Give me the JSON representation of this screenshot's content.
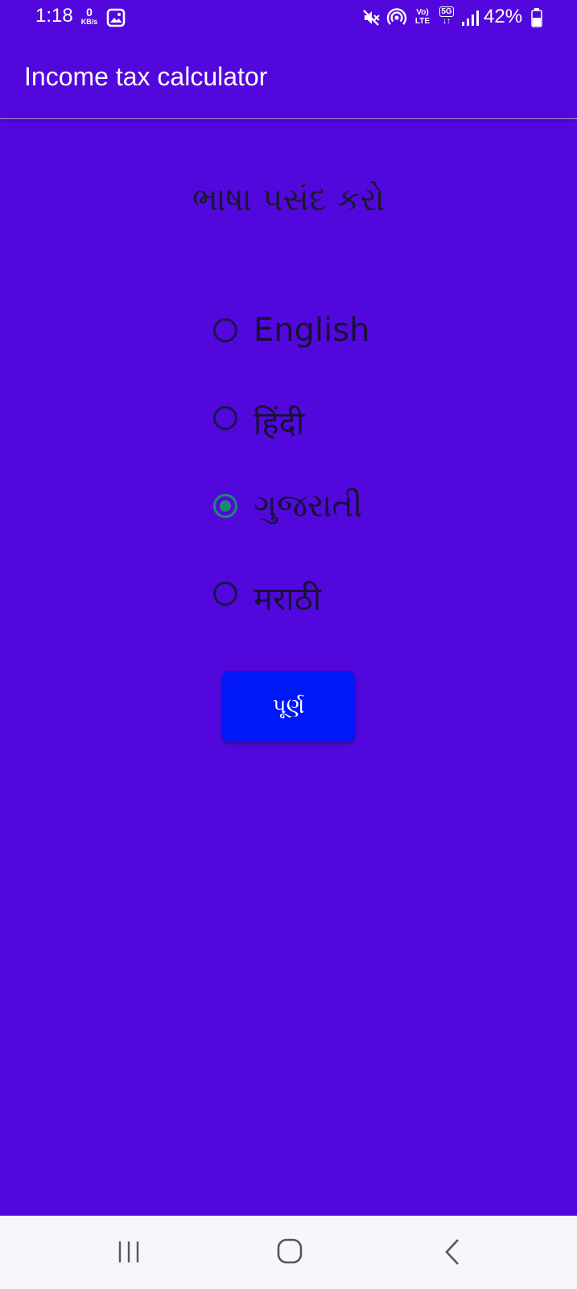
{
  "status_bar": {
    "time": "1:18",
    "net_speed_value": "0",
    "net_speed_unit": "KB/s",
    "volte_line1": "Vo)",
    "volte_line2": "LTE",
    "network_type": "5G",
    "battery_percent": "42%",
    "icons": [
      "gallery-icon",
      "mute-icon",
      "hotspot-icon",
      "volte-icon",
      "network-5g-icon",
      "signal-icon",
      "battery-icon"
    ]
  },
  "app_bar": {
    "title": "Income tax calculator"
  },
  "main": {
    "heading": "ભાષા પસંદ કરો",
    "language_options": [
      {
        "label": "English",
        "selected": false
      },
      {
        "label": "हिंदी",
        "selected": false
      },
      {
        "label": "ગુજરાતી",
        "selected": true
      },
      {
        "label": "मराठी",
        "selected": false
      }
    ],
    "done_button_label": "પૂર્ણ"
  },
  "nav_bar": {
    "icons": [
      "recent-apps-icon",
      "home-icon",
      "back-icon"
    ]
  },
  "colors": {
    "background": "#5208DC",
    "button": "#0018F8",
    "radio_selected": "#1b8a72",
    "nav_bar": "#f7f6fa"
  }
}
